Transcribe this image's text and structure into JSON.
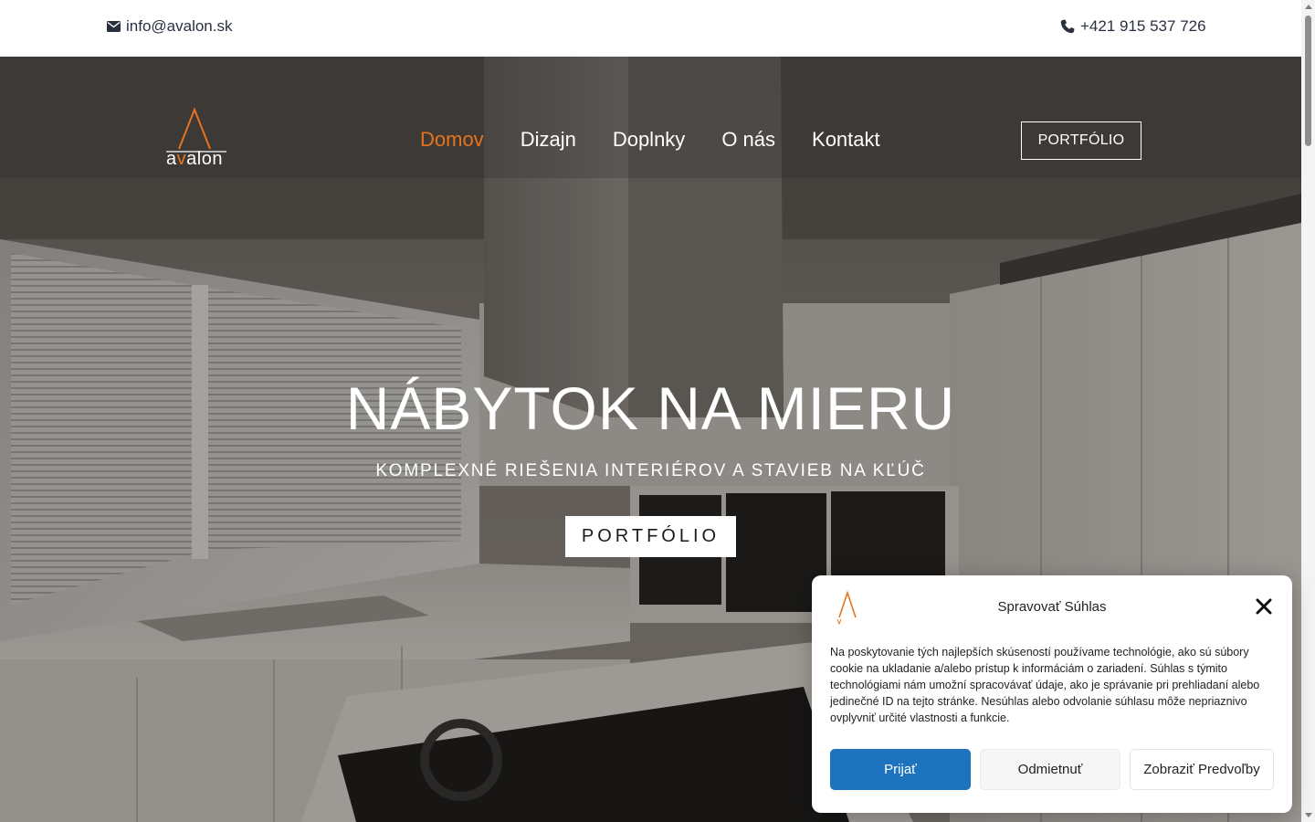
{
  "topbar": {
    "email": "info@avalon.sk",
    "phone": "+421 915 537 726"
  },
  "header": {
    "logo_text_prefix": "a",
    "logo_text_accent": "v",
    "logo_text_suffix": "alon",
    "nav": [
      {
        "label": "Domov",
        "active": true
      },
      {
        "label": "Dizajn",
        "active": false
      },
      {
        "label": "Doplnky",
        "active": false
      },
      {
        "label": "O nás",
        "active": false
      },
      {
        "label": "Kontakt",
        "active": false
      }
    ],
    "portfolio_button": "PORTFÓLIO"
  },
  "hero": {
    "title": "NÁBYTOK NA MIERU",
    "subtitle": "KOMPLEXNÉ RIEŠENIA INTERIÉROV A STAVIEB NA KĽÚČ",
    "button": "PORTFÓLIO"
  },
  "cookie_dialog": {
    "title": "Spravovať Súhlas",
    "body": "Na poskytovanie tých najlepších skúseností používame technológie, ako sú súbory cookie na ukladanie a/alebo prístup k informáciám o zariadení. Súhlas s týmito technológiami nám umožní spracovávať údaje, ako je správanie pri prehliadaní alebo jedinečné ID na tejto stránke. Nesúhlas alebo odvolanie súhlasu môže nepriaznivo ovplyvniť určité vlastnosti a funkcie.",
    "accept": "Prijať",
    "deny": "Odmietnuť",
    "preferences": "Zobraziť Predvoľby"
  },
  "colors": {
    "accent": "#e8731d",
    "primary_button": "#1e73be"
  }
}
